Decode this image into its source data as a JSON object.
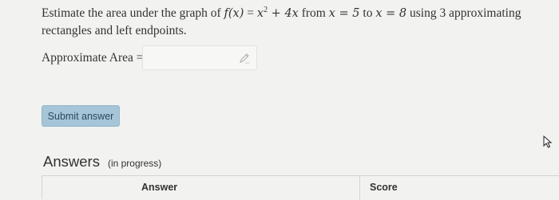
{
  "question": {
    "prefix": "Estimate the area under the graph of",
    "fx": "f(x)",
    "eq": " = ",
    "x": "x",
    "exp": "2",
    "rest_expr": " + 4x",
    "from": " from ",
    "x_from": "x = 5",
    "to": " to ",
    "x_to": "x = 8",
    "using": " using 3 approximating rectangles and left endpoints."
  },
  "area": {
    "label": "Approximate Area =",
    "value": ""
  },
  "submit": {
    "label": "Submit answer"
  },
  "answers": {
    "title": "Answers",
    "status": "(in progress)",
    "columns": [
      "Answer",
      "Score"
    ]
  },
  "icons": {
    "pencil": "pencil-icon",
    "cursor": "cursor-icon"
  }
}
